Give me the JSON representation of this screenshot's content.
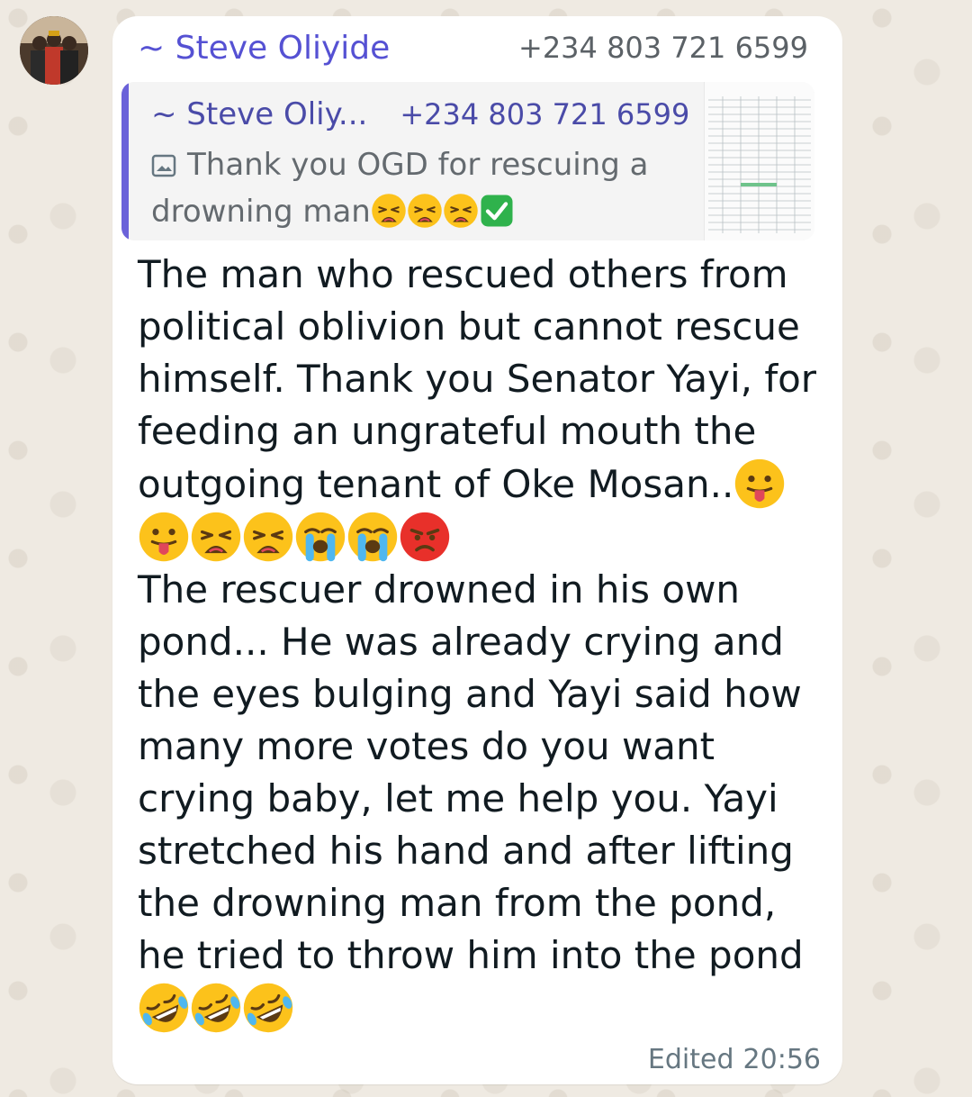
{
  "message": {
    "sender_name": "~ Steve Oliyide",
    "sender_phone": "+234 803 721 6599",
    "quoted": {
      "sender_name": "~ Steve Oliy...",
      "sender_phone": "+234 803 721 6599",
      "text": "Thank you OGD for rescuing a drowning man",
      "media_icon": "image-icon",
      "emojis": [
        "tired-face",
        "tired-face",
        "tired-face",
        "check-mark-button"
      ]
    },
    "paragraph_1": "The man who rescued others from political oblivion but cannot rescue himself. Thank you Senator Yayi, for feeding an ungrateful mouth the outgoing tenant of Oke Mosan..",
    "paragraph_1_emojis": [
      "face-with-tongue",
      "face-with-tongue",
      "weary-face",
      "weary-face",
      "loudly-crying-face",
      "loudly-crying-face",
      "pouting-face"
    ],
    "paragraph_2": "The rescuer drowned in his own pond... He was already crying and the eyes bulging and Yayi said how many more votes do you want crying baby, let me help you. Yayi stretched his hand and after lifting the drowning man from the pond, he tried to throw him into the pond",
    "paragraph_2_emojis": [
      "rolling-on-floor-laughing",
      "rolling-on-floor-laughing",
      "rolling-on-floor-laughing"
    ],
    "edited_label": "Edited",
    "time": "20:56"
  },
  "colors": {
    "sender_name": "#5551d3",
    "quote_bar": "#6b62d9",
    "bubble": "#ffffff",
    "wallpaper": "#efeae2"
  }
}
